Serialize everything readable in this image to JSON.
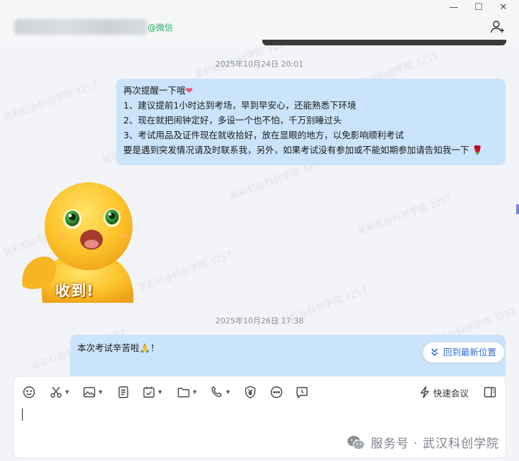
{
  "header": {
    "contact_source": "@微信",
    "window_controls": {
      "minimize": "—",
      "maximize": "☐",
      "close": "✕"
    }
  },
  "messages": [
    {
      "type": "timestamp",
      "text": "2025年10月24日 20:01"
    },
    {
      "type": "bubble",
      "lines": [
        "再次提醒一下哦",
        "1、建议提前1小时达到考场，早到早安心，还能熟悉下环境",
        "2、现在就把闹钟定好，多设一个也不怕，千万别睡过头",
        "3、考试用品及证件现在就收拾好，放在显眼的地方，以免影响顺利考试",
        "要是遇到突发情况请及时联系我，另外，如果考试没有参加或不能如期参加请告知我一下"
      ],
      "emoji_end_first": "❤",
      "emoji_end_last": "🌹"
    },
    {
      "type": "sticker",
      "caption": "收到!"
    },
    {
      "type": "timestamp",
      "text": "2025年10月26日 17:38"
    },
    {
      "type": "bubble",
      "lines": [
        "本次考试辛苦啦",
        ""
      ],
      "emoji_after_first": "🙏",
      "first_suffix": "！"
    }
  ],
  "watermark_text": "吴彩虹@科创学院 3257",
  "scroll_button": {
    "label": "回到最新位置",
    "icon": "double-chevron-down-icon"
  },
  "toolbar": {
    "icons": [
      "emoji-icon",
      "scissors-icon",
      "image-icon",
      "document-icon",
      "calendar-check-icon",
      "folder-icon",
      "phone-icon",
      "yuan-shield-icon",
      "more-icon",
      "chat-history-icon"
    ],
    "meeting_label": "快速会议",
    "panel_icon": "side-panel-icon"
  },
  "brand": {
    "text": "服务号 · 武汉科创学院"
  },
  "colors": {
    "bubble": "#c9e4fb",
    "accent": "#2f6bd8",
    "wechat_green": "#2aae67"
  }
}
